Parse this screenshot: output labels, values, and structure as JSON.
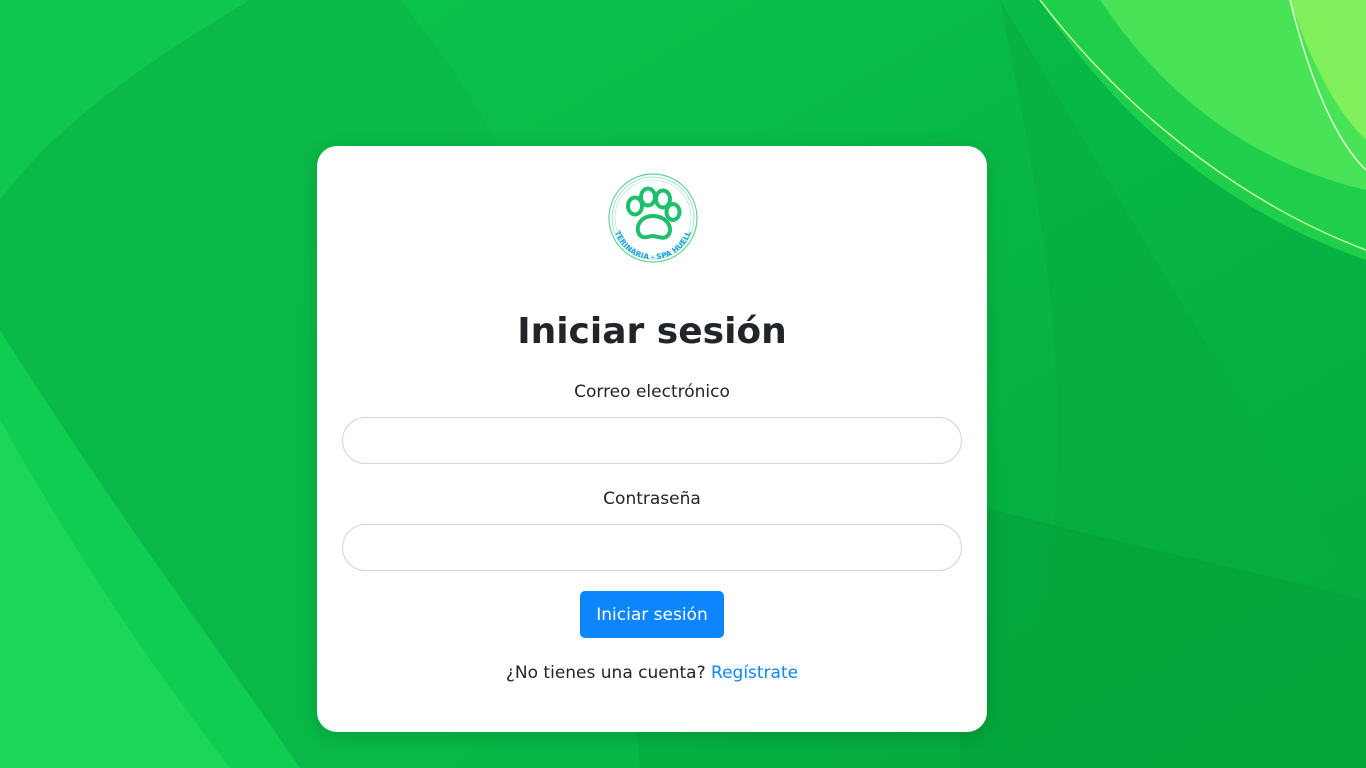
{
  "login": {
    "title": "Iniciar sesión",
    "email_label": "Correo electrónico",
    "email_value": "",
    "password_label": "Contraseña",
    "password_value": "",
    "submit_label": "Iniciar sesión",
    "no_account_text": "¿No tienes una cuenta?",
    "register_link": "Regístrate"
  },
  "logo": {
    "text": "VETERINARIA - SPA HUELLAS",
    "icon": "paw-icon"
  },
  "colors": {
    "background": "#05ad40",
    "accent": "#0d86fd",
    "logo_green": "#1fbf6e",
    "logo_text": "#1aa0e0"
  }
}
